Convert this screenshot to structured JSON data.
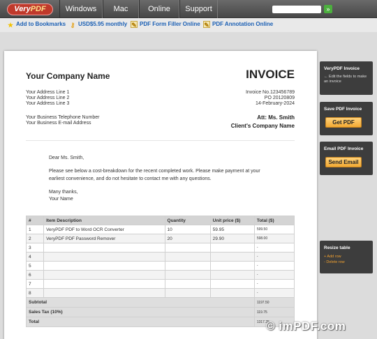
{
  "nav": {
    "logo_part1": "Very",
    "logo_part2": "PDF",
    "tabs": [
      "Windows",
      "Mac",
      "Online",
      "Support"
    ],
    "search_button": "»"
  },
  "linkbar": {
    "items": [
      {
        "label": "Add to Bookmarks",
        "icon": "star-icon"
      },
      {
        "label": "USD$5.95 monthly",
        "icon": "key-icon"
      },
      {
        "label": "PDF Form Filler Online",
        "icon": "pencil-doc-icon"
      },
      {
        "label": "PDF Annotation Online",
        "icon": "pencil-doc-icon"
      }
    ]
  },
  "invoice": {
    "company": "Your Company Name",
    "title": "INVOICE",
    "address": [
      "Your Address Line 1",
      "Your Address Line 2",
      "Your Address Line 3"
    ],
    "contact": [
      "Your Business Telephone Number",
      "Your Business E-mail Address"
    ],
    "invoice_no": "Invoice No.123456789",
    "po": "PO 20120809",
    "date": "14-February-2024",
    "att": "Att: Ms. Smith",
    "client_company": "Client's Company Name",
    "greeting": "Dear Ms. Smith,",
    "body_line1": "Please see below a cost-breakdown for the recent completed work. Please make payment at your",
    "body_line2": "earliest convenience, and do not hesitate to contact me with any questions.",
    "thanks": "Many thanks,",
    "sign": "Your Name",
    "table": {
      "headers": [
        "#",
        "Item Description",
        "Quantity",
        "Unit price ($)",
        "Total ($)"
      ],
      "rows": [
        [
          "1",
          "VeryPDF PDF to Word OCR Converter",
          "10",
          "59.95",
          "599.50"
        ],
        [
          "2",
          "VeryPDF PDF Password Remover",
          "20",
          "29.90",
          "598.00"
        ],
        [
          "3",
          "",
          "",
          "",
          "-"
        ],
        [
          "4",
          "",
          "",
          "",
          "-"
        ],
        [
          "5",
          "",
          "",
          "",
          "-"
        ],
        [
          "6",
          "",
          "",
          "",
          "-"
        ],
        [
          "7",
          "",
          "",
          "",
          "-"
        ],
        [
          "8",
          "",
          "",
          "",
          "-"
        ]
      ],
      "subtotal_label": "Subtotal",
      "subtotal": "1197.50",
      "tax_label": "Sales Tax (10%)",
      "tax": "119.75",
      "total_label": "Total",
      "total": "1317.25"
    }
  },
  "panels": {
    "invoice_panel_title": "VeryPDF Invoice",
    "invoice_panel_hint": "← Edit the fields to make an invoice",
    "save_title": "Save PDF Invoice",
    "save_button": "Get PDF",
    "email_title": "Email PDF Invoice",
    "email_button": "Send Email",
    "resize_title": "Resize table",
    "add_row": "+ Add row",
    "delete_row": "- Delete row"
  },
  "watermark": "© imPDF.com",
  "colors": {
    "nav_bg": "#555555",
    "link": "#1a5fb4",
    "panel_bg": "#3d3d3d",
    "button_orange": "#f3a933"
  }
}
